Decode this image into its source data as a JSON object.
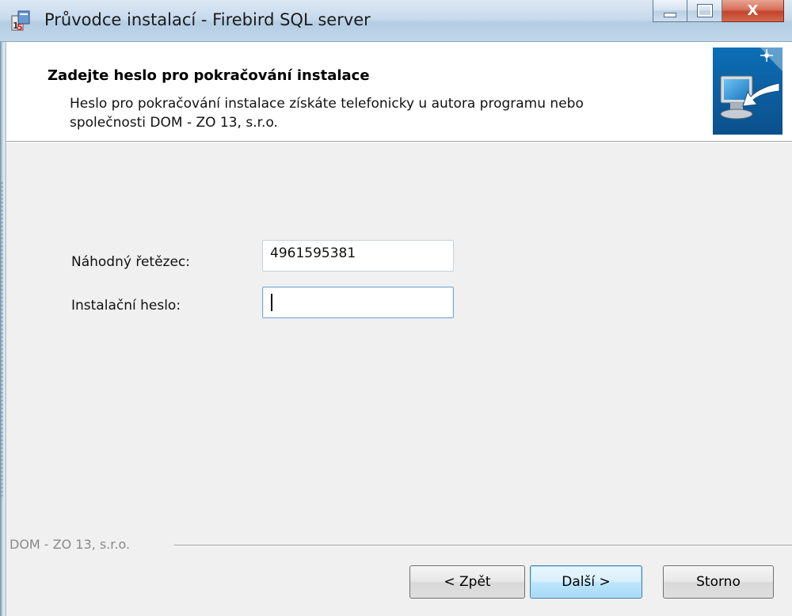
{
  "window": {
    "title": "Průvodce instalací - Firebird SQL server",
    "controls": {
      "minimize": "minimize",
      "maximize": "maximize",
      "close": "X"
    }
  },
  "header": {
    "title": "Zadejte heslo pro pokračování instalace",
    "subtitle": "Heslo pro pokračování instalace získáte telefonicky u autora programu nebo společnosti DOM - ZO 13, s.r.o."
  },
  "form": {
    "random_label": "Náhodný řetězec:",
    "random_value": "4961595381",
    "password_label": "Instalační heslo:",
    "password_value": ""
  },
  "footer": {
    "brand": "DOM - ZO 13, s.r.o.",
    "back_label": "< Zpět",
    "next_label": "Další >",
    "cancel_label": "Storno"
  },
  "icons": {
    "app": "installer-icon",
    "banner": "computer-arrow-icon"
  }
}
